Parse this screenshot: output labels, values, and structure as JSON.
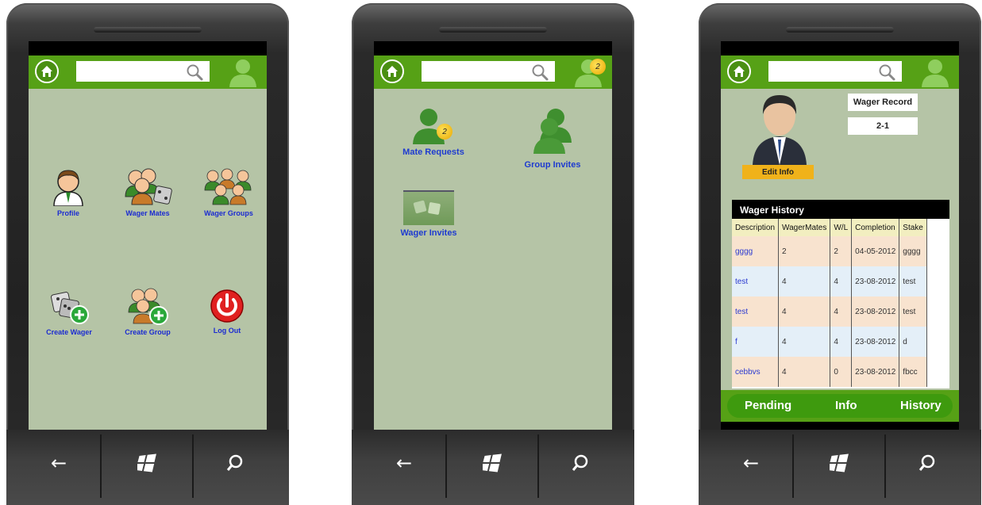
{
  "colors": {
    "accent": "#56a116",
    "content_bg": "#b5c4a6",
    "link": "#1b2bd1",
    "badge": "#f5c518"
  },
  "screen1": {
    "tiles": [
      {
        "label": "Profile",
        "icon": "profile-icon"
      },
      {
        "label": "Wager Mates",
        "icon": "wager-mates-icon"
      },
      {
        "label": "Wager Groups",
        "icon": "wager-groups-icon"
      },
      {
        "label": "Create Wager",
        "icon": "create-wager-icon"
      },
      {
        "label": "Create Group",
        "icon": "create-group-icon"
      },
      {
        "label": "Log Out",
        "icon": "power-icon"
      }
    ]
  },
  "screen2": {
    "avatar_badge": "2",
    "tiles": [
      {
        "label": "Mate Requests",
        "badge": "2"
      },
      {
        "label": "Group Invites"
      },
      {
        "label": "Wager Invites"
      }
    ]
  },
  "screen3": {
    "edit_info": "Edit Info",
    "record_label": "Wager Record",
    "record_value": "2-1",
    "history_title": "Wager History",
    "columns": [
      "Description",
      "WagerMates",
      "W/L",
      "Completion",
      "Stake"
    ],
    "rows": [
      {
        "description": "gggg",
        "mates": "2",
        "wl": "2",
        "completion": "04-05-2012",
        "stake": "gggg"
      },
      {
        "description": "test",
        "mates": "4",
        "wl": "4",
        "completion": "23-08-2012",
        "stake": "test"
      },
      {
        "description": "test",
        "mates": "4",
        "wl": "4",
        "completion": "23-08-2012",
        "stake": "test"
      },
      {
        "description": "f",
        "mates": "4",
        "wl": "4",
        "completion": "23-08-2012",
        "stake": "d"
      },
      {
        "description": "cebbvs",
        "mates": "4",
        "wl": "0",
        "completion": "23-08-2012",
        "stake": "fbcc"
      }
    ],
    "tabs": [
      "Pending",
      "Info",
      "History"
    ]
  }
}
